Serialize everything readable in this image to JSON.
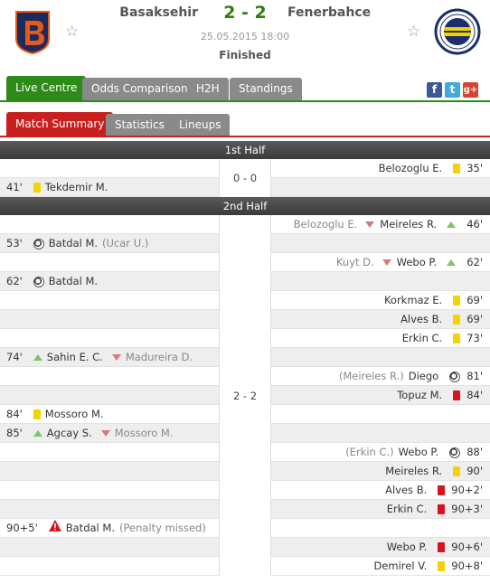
{
  "match": {
    "home_team": "Basaksehir",
    "away_team": "Fenerbahce",
    "score": "2 - 2",
    "date": "25.05.2015 18:00",
    "status": "Finished"
  },
  "main_tabs": [
    "Live Centre",
    "Odds Comparison",
    "H2H",
    "Standings"
  ],
  "sub_tabs": [
    "Match Summary",
    "Statistics",
    "Lineups"
  ],
  "colors": {
    "accent_green": "#2e8b17",
    "accent_red": "#c8201f",
    "yellow_card": "#f6d200",
    "red_card": "#d8131f"
  },
  "first_half": {
    "title": "1st Half",
    "score": "0 - 0",
    "rows": [
      {
        "side": "away",
        "minute": "35'",
        "icon": "yellow-card",
        "player": "Belozoglu E.",
        "other": ""
      },
      {
        "side": "home",
        "minute": "41'",
        "icon": "yellow-card",
        "player": "Tekdemir M.",
        "other": ""
      }
    ]
  },
  "second_half": {
    "title": "2nd Half",
    "score": "2 - 2",
    "rows": [
      {
        "side": "away",
        "minute": "46'",
        "icon": "substitution",
        "player": "Meireles R.",
        "other": "Belozoglu E."
      },
      {
        "side": "home",
        "minute": "53'",
        "icon": "goal",
        "player": "Batdal M.",
        "other": "(Ucar U.)"
      },
      {
        "side": "away",
        "minute": "62'",
        "icon": "substitution",
        "player": "Webo P.",
        "other": "Kuyt D."
      },
      {
        "side": "home",
        "minute": "62'",
        "icon": "goal",
        "player": "Batdal M.",
        "other": ""
      },
      {
        "side": "away",
        "minute": "69'",
        "icon": "yellow-card",
        "player": "Korkmaz E.",
        "other": ""
      },
      {
        "side": "away",
        "minute": "69'",
        "icon": "yellow-card",
        "player": "Alves B.",
        "other": ""
      },
      {
        "side": "away",
        "minute": "73'",
        "icon": "yellow-card",
        "player": "Erkin C.",
        "other": ""
      },
      {
        "side": "home",
        "minute": "74'",
        "icon": "substitution",
        "player": "Sahin E. C.",
        "other": "Madureira D."
      },
      {
        "side": "away",
        "minute": "81'",
        "icon": "goal",
        "player": "Diego",
        "other": "(Meireles R.)"
      },
      {
        "side": "away",
        "minute": "84'",
        "icon": "red-card",
        "player": "Topuz M.",
        "other": ""
      },
      {
        "side": "home",
        "minute": "84'",
        "icon": "yellow-card",
        "player": "Mossoro M.",
        "other": ""
      },
      {
        "side": "home",
        "minute": "85'",
        "icon": "substitution",
        "player": "Agcay S.",
        "other": "Mossoro M."
      },
      {
        "side": "away",
        "minute": "88'",
        "icon": "goal",
        "player": "Webo P.",
        "other": "(Erkin C.)"
      },
      {
        "side": "away",
        "minute": "90'",
        "icon": "yellow-card",
        "player": "Meireles R.",
        "other": ""
      },
      {
        "side": "away",
        "minute": "90+2'",
        "icon": "red-card",
        "player": "Alves B.",
        "other": ""
      },
      {
        "side": "away",
        "minute": "90+3'",
        "icon": "red-card",
        "player": "Erkin C.",
        "other": ""
      },
      {
        "side": "home",
        "minute": "90+5'",
        "icon": "penalty-missed",
        "player": "Batdal M.",
        "other": "(Penalty missed)"
      },
      {
        "side": "away",
        "minute": "90+6'",
        "icon": "red-card",
        "player": "Webo P.",
        "other": ""
      },
      {
        "side": "away",
        "minute": "90+8'",
        "icon": "yellow-card",
        "player": "Demirel V.",
        "other": ""
      }
    ]
  }
}
